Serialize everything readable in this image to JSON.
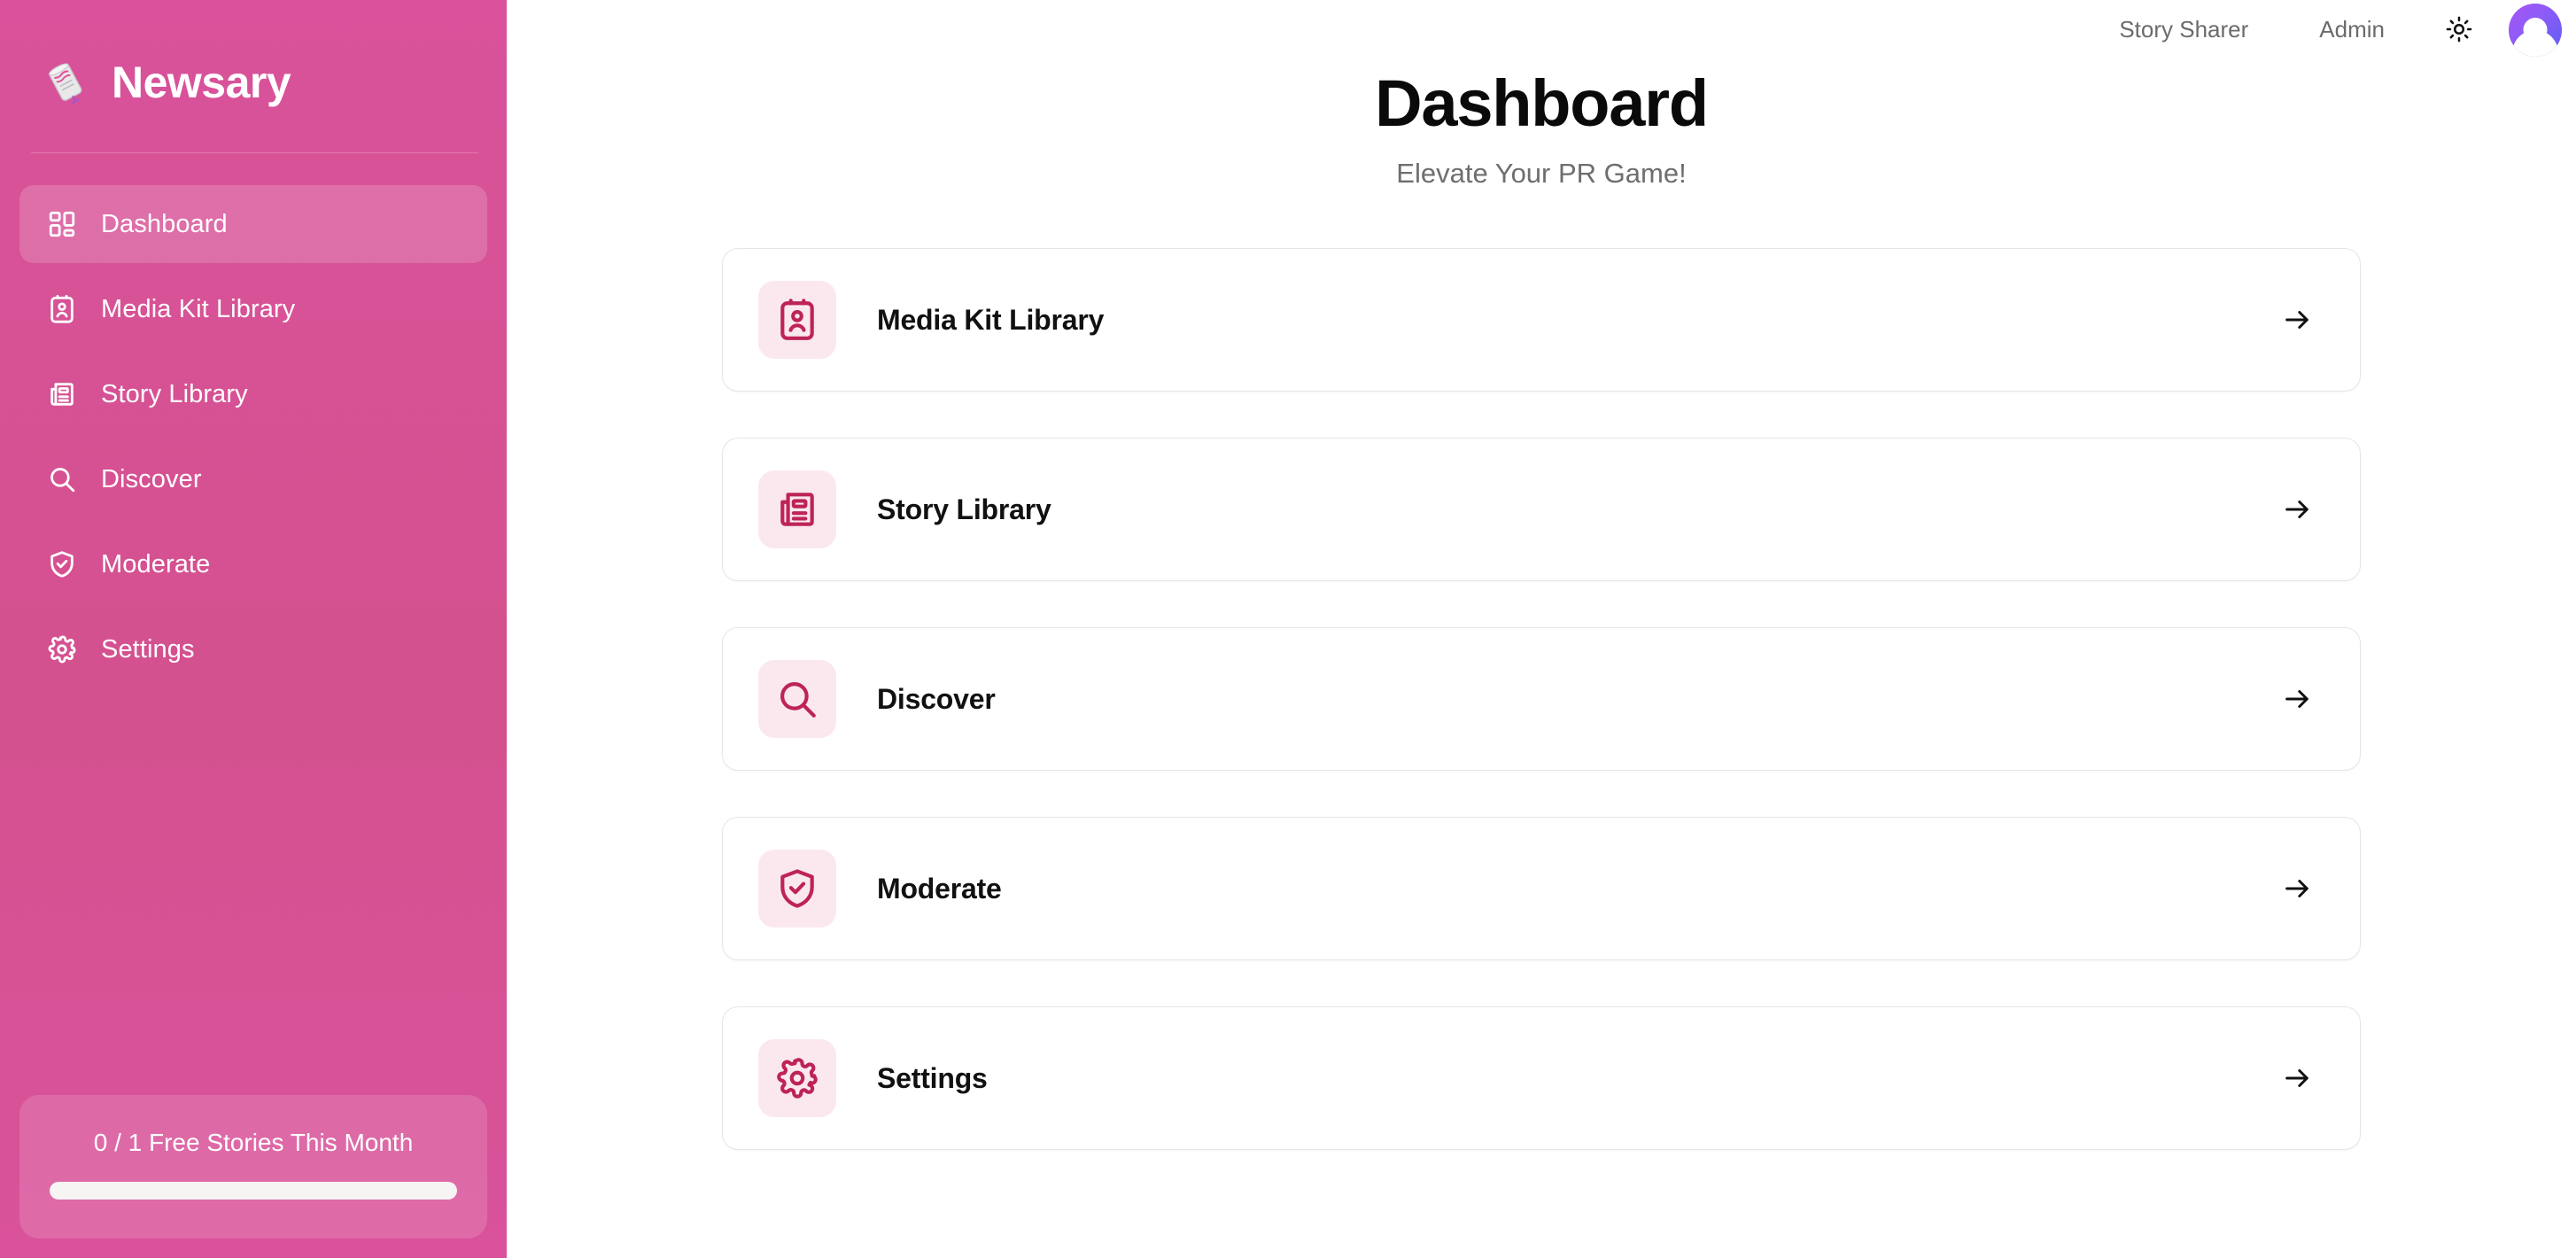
{
  "brand": {
    "name": "Newsary",
    "logo_icon": "rolled-newspaper-icon"
  },
  "sidebar": {
    "items": [
      {
        "label": "Dashboard",
        "icon": "grid-dashboard-icon",
        "active": true
      },
      {
        "label": "Media Kit Library",
        "icon": "id-card-icon",
        "active": false
      },
      {
        "label": "Story Library",
        "icon": "newspaper-icon",
        "active": false
      },
      {
        "label": "Discover",
        "icon": "search-icon",
        "active": false
      },
      {
        "label": "Moderate",
        "icon": "shield-check-icon",
        "active": false
      },
      {
        "label": "Settings",
        "icon": "gear-icon",
        "active": false
      }
    ],
    "quota": {
      "text": "0 / 1 Free Stories This Month",
      "progress_percent": 100
    }
  },
  "topbar": {
    "role_label": "Story Sharer",
    "account_label": "Admin",
    "theme_toggle_icon": "sun-icon",
    "avatar_icon": "user-avatar"
  },
  "header": {
    "title": "Dashboard",
    "subtitle": "Elevate Your PR Game!"
  },
  "cards": [
    {
      "title": "Media Kit Library",
      "icon": "id-card-icon",
      "arrow": "arrow-right-icon"
    },
    {
      "title": "Story Library",
      "icon": "newspaper-icon",
      "arrow": "arrow-right-icon"
    },
    {
      "title": "Discover",
      "icon": "search-icon",
      "arrow": "arrow-right-icon"
    },
    {
      "title": "Moderate",
      "icon": "shield-check-icon",
      "arrow": "arrow-right-icon"
    },
    {
      "title": "Settings",
      "icon": "gear-icon",
      "arrow": "arrow-right-icon"
    }
  ],
  "colors": {
    "sidebar_pink": "#d9529b",
    "accent_dark_pink": "#bd2359",
    "icon_tile_bg": "#fbe8ef",
    "avatar_gradient_start": "#a855f7",
    "avatar_gradient_end": "#5b5ef2"
  }
}
